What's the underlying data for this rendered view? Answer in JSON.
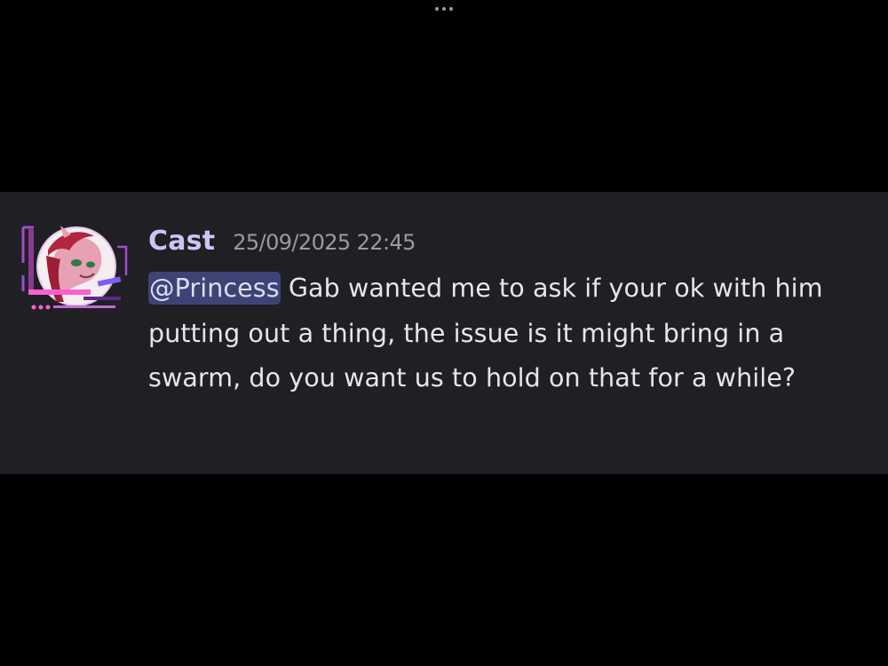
{
  "message": {
    "author": "Cast",
    "timestamp": "25/09/2025 22:45",
    "mention": "@Princess",
    "text": " Gab wanted me to ask if your ok with him putting out a thing, the issue is it might bring in a swarm, do you want us to hold on that for a while?"
  },
  "icons": {
    "more": "more-horizontal-icon",
    "avatar": "user-avatar"
  },
  "colors": {
    "background": "#000000",
    "card": "#1f1f24",
    "username": "#c9c6f6",
    "mention_bg": "#3e4376",
    "text": "#e6e6ea",
    "timestamp": "#9a9aa2"
  }
}
